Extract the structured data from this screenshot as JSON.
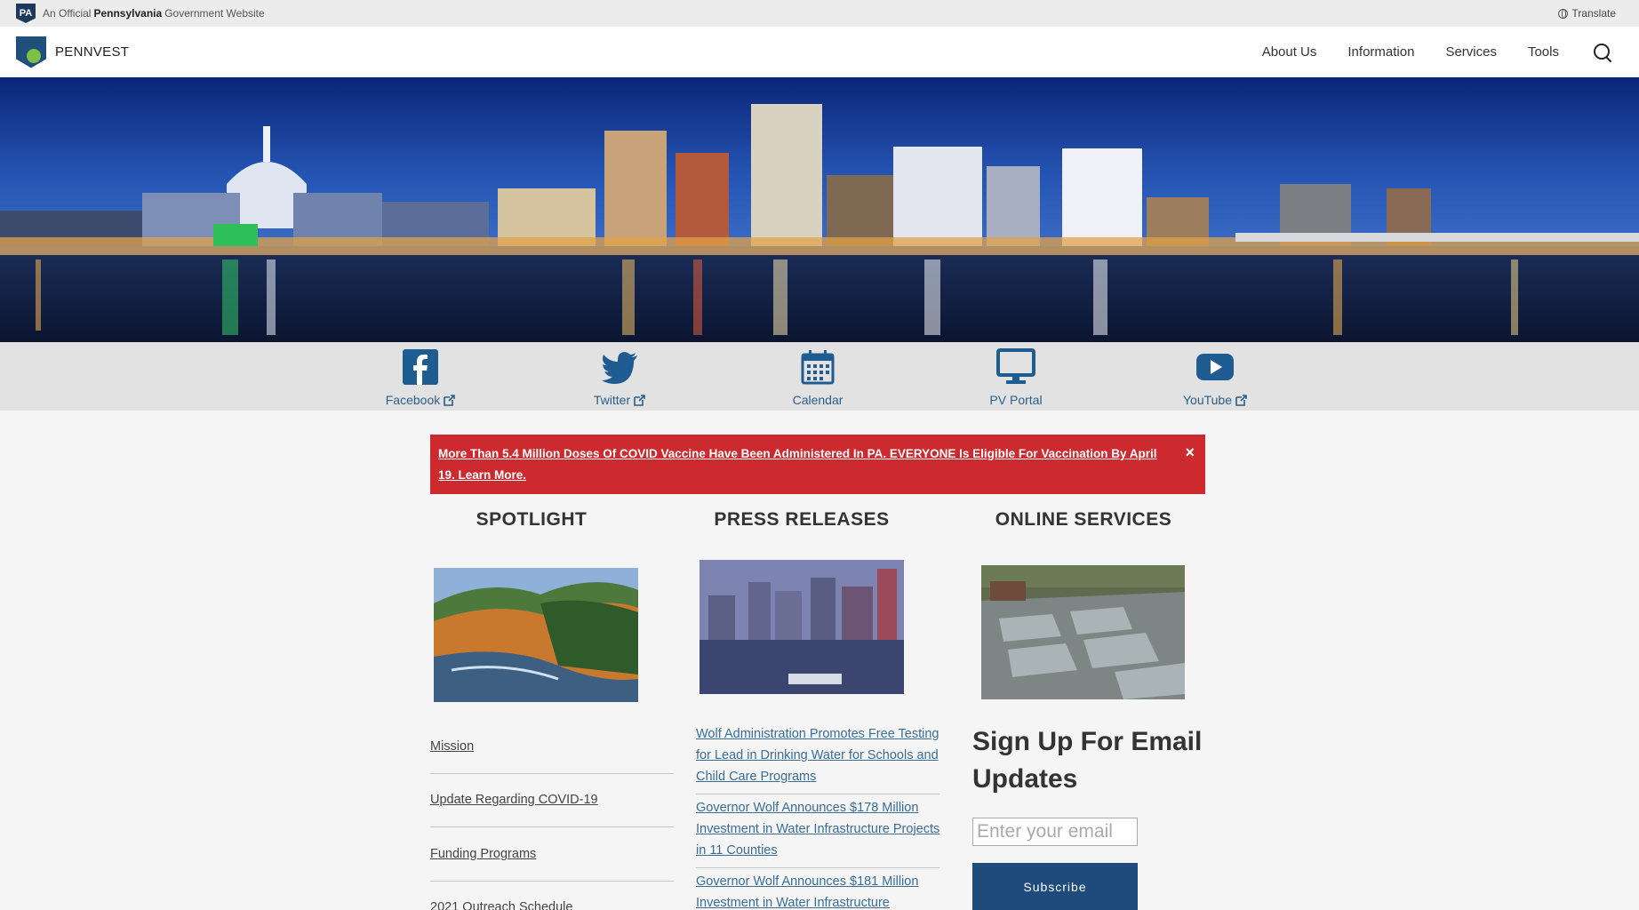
{
  "gov_bar": {
    "prefix": "An Official",
    "state": "Pennsylvania",
    "suffix": "Government Website",
    "badge": "PA",
    "translate": "Translate"
  },
  "header": {
    "brand": "PENNVEST",
    "nav": [
      "About Us",
      "Information",
      "Services",
      "Tools"
    ]
  },
  "social": [
    {
      "label": "Facebook",
      "icon": "facebook-icon",
      "external": true
    },
    {
      "label": "Twitter",
      "icon": "twitter-icon",
      "external": true
    },
    {
      "label": "Calendar",
      "icon": "calendar-icon",
      "external": false
    },
    {
      "label": "PV Portal",
      "icon": "monitor-icon",
      "external": false
    },
    {
      "label": "YouTube",
      "icon": "youtube-icon",
      "external": true
    }
  ],
  "alert": {
    "text": "More Than 5.4 Million Doses Of COVID Vaccine Have Been Administered In PA. EVERYONE Is Eligible For Vaccination By April 19. Learn More.",
    "close": "×"
  },
  "columns": {
    "spotlight": {
      "title": "SPOTLIGHT",
      "links": [
        "Mission",
        "Update Regarding COVID-19",
        "Funding Programs",
        "2021 Outreach Schedule"
      ]
    },
    "press": {
      "title": "PRESS RELEASES",
      "links": [
        "Wolf Administration Promotes Free Testing for Lead in Drinking Water for Schools and Child Care Programs",
        "Governor Wolf Announces $178 Million Investment in Water Infrastructure Projects in 11 Counties",
        "Governor Wolf Announces $181 Million Investment in Water Infrastructure"
      ]
    },
    "online": {
      "title": "ONLINE SERVICES"
    }
  },
  "signup": {
    "title": "Sign Up For Email Updates",
    "placeholder": "Enter your email",
    "button": "Subscribe"
  },
  "colors": {
    "alert": "#cc2a2f",
    "link": "#2a5f88",
    "button": "#1f4b7c"
  }
}
